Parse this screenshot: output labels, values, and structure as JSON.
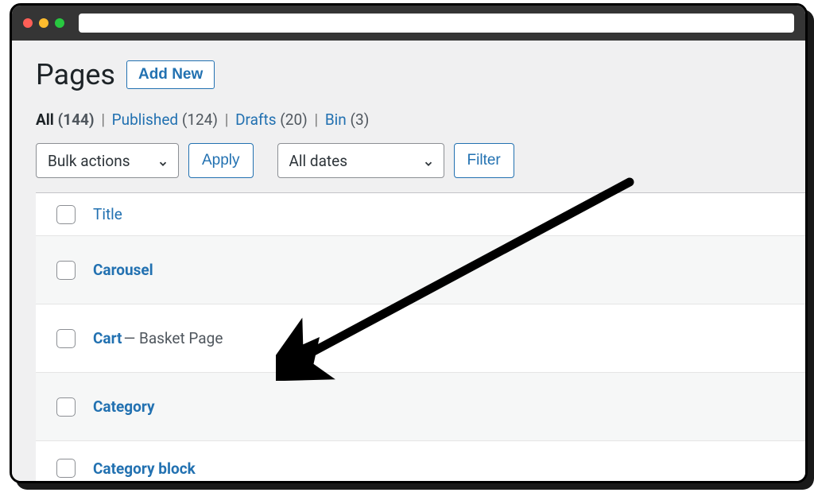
{
  "header": {
    "title": "Pages",
    "add_new_label": "Add New"
  },
  "filters": {
    "all_label": "All",
    "all_count": "(144)",
    "published_label": "Published",
    "published_count": "(124)",
    "drafts_label": "Drafts",
    "drafts_count": "(20)",
    "bin_label": "Bin",
    "bin_count": "(3)"
  },
  "tablenav": {
    "bulk_label": "Bulk actions",
    "apply_label": "Apply",
    "dates_label": "All dates",
    "filter_label": "Filter"
  },
  "table": {
    "title_header": "Title",
    "rows": [
      {
        "title": "Carousel",
        "suffix": ""
      },
      {
        "title": "Cart",
        "suffix": " — Basket Page"
      },
      {
        "title": "Category",
        "suffix": ""
      },
      {
        "title": "Category block",
        "suffix": ""
      }
    ]
  }
}
